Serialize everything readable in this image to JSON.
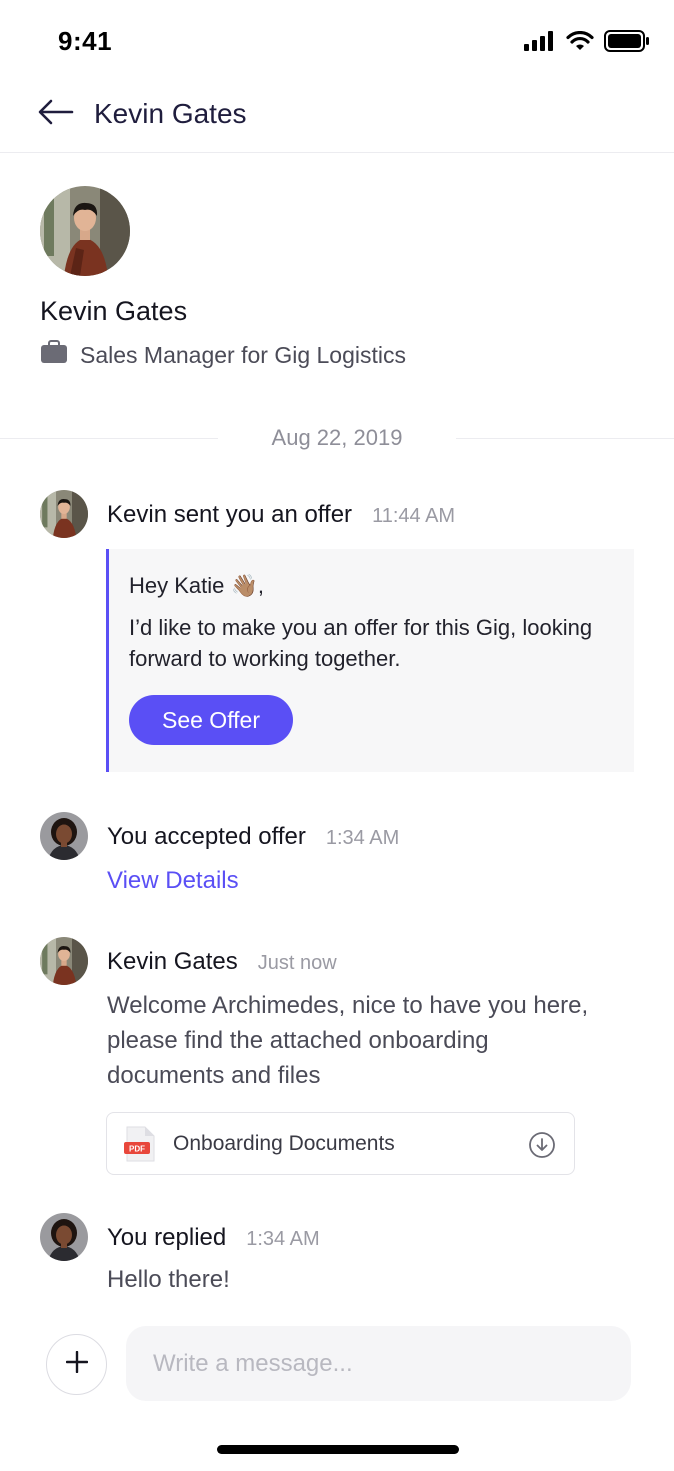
{
  "status_bar": {
    "time": "9:41"
  },
  "header": {
    "title": "Kevin Gates"
  },
  "profile": {
    "name": "Kevin Gates",
    "role": "Sales Manager for Gig Logistics"
  },
  "date_divider": "Aug 22, 2019",
  "messages": [
    {
      "sender": "Kevin sent you an offer",
      "time": "11:44 AM",
      "greeting": "Hey Katie 👋🏽,",
      "body": "I’d like to make you an offer for this Gig, looking forward to working together.",
      "button_label": "See Offer"
    },
    {
      "sender": "You accepted offer",
      "time": "1:34 AM",
      "link_label": "View Details"
    },
    {
      "sender": "Kevin Gates",
      "time": "Just now",
      "body": "Welcome Archimedes, nice to have you here, please find the attached onboarding documents and files",
      "attachment": {
        "name": "Onboarding Documents",
        "type_label": "PDF"
      }
    },
    {
      "sender": "You replied",
      "time": "1:34 AM",
      "body": "Hello there!"
    }
  ],
  "composer": {
    "placeholder": "Write a message..."
  },
  "colors": {
    "accent": "#5a4ff5",
    "header_text": "#1f1d3d",
    "pdf_red": "#e8473b"
  },
  "icons": [
    "back-arrow-icon",
    "briefcase-icon",
    "pdf-file-icon",
    "download-icon",
    "plus-icon",
    "signal-icon",
    "wifi-icon",
    "battery-icon"
  ]
}
